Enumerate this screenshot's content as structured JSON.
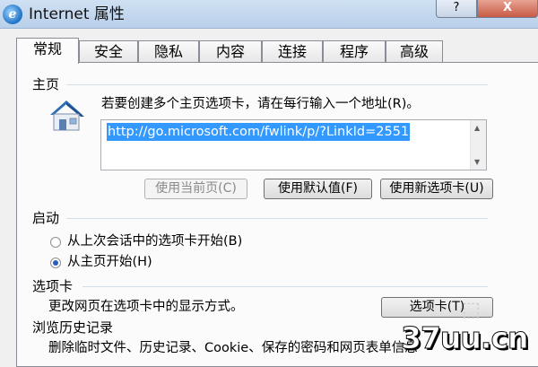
{
  "window": {
    "title": "Internet 属性",
    "app_icon": "ie-icon",
    "help_label": "?",
    "close_label": "X"
  },
  "tabs": [
    {
      "label": "常规",
      "active": true
    },
    {
      "label": "安全"
    },
    {
      "label": "隐私"
    },
    {
      "label": "内容"
    },
    {
      "label": "连接"
    },
    {
      "label": "程序"
    },
    {
      "label": "高级"
    }
  ],
  "homepage": {
    "title": "主页",
    "instructions": "若要创建多个主页选项卡，请在每行输入一个地址(R)。",
    "url_value": "http://go.microsoft.com/fwlink/p/?LinkId=2551",
    "use_current_label": "使用当前页(C)",
    "use_default_label": "使用默认值(F)",
    "use_new_tab_label": "使用新选项卡(U)"
  },
  "startup": {
    "title": "启动",
    "option_last_session": "从上次会话中的选项卡开始(B)",
    "option_homepage": "从主页开始(H)",
    "selected": "option_homepage"
  },
  "tabs_section": {
    "title": "选项卡",
    "description": "更改网页在选项卡中的显示方式。",
    "button_label": "选项卡(T)"
  },
  "history": {
    "title": "浏览历史记录",
    "description": "删除临时文件、历史记录、Cookie、保存的密码和网页表单信息"
  },
  "watermark": {
    "text": "37uu.cn"
  },
  "colors": {
    "selection": "#3399ff",
    "titlebar": "#b9d0ea"
  }
}
